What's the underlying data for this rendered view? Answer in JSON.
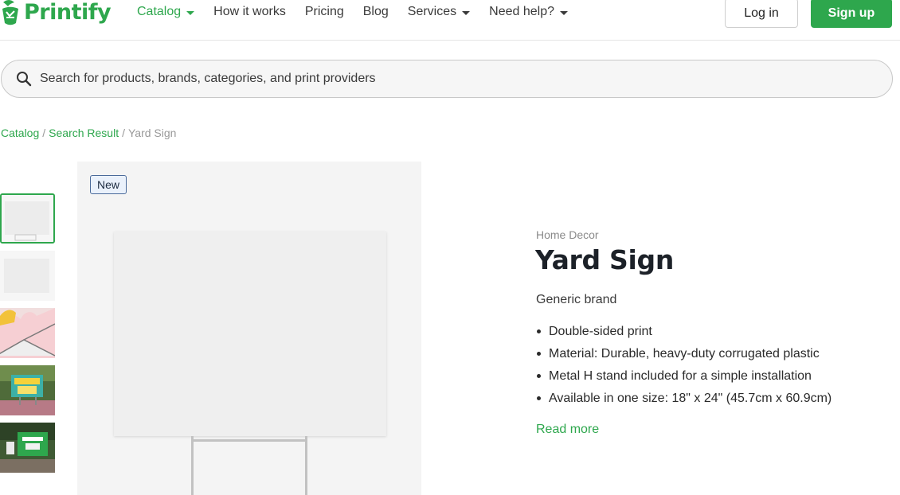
{
  "header": {
    "logo_text": "Printify",
    "nav": [
      {
        "label": "Catalog",
        "dropdown": true,
        "active": true
      },
      {
        "label": "How it works",
        "dropdown": false,
        "active": false
      },
      {
        "label": "Pricing",
        "dropdown": false,
        "active": false
      },
      {
        "label": "Blog",
        "dropdown": false,
        "active": false
      },
      {
        "label": "Services",
        "dropdown": true,
        "active": false
      },
      {
        "label": "Need help?",
        "dropdown": true,
        "active": false
      }
    ],
    "login_label": "Log in",
    "signup_label": "Sign up"
  },
  "search": {
    "placeholder": "Search for products, brands, categories, and print providers"
  },
  "breadcrumb": [
    {
      "label": "Catalog",
      "link": true
    },
    {
      "label": "Search Result",
      "link": true
    },
    {
      "label": "Yard Sign",
      "link": false
    }
  ],
  "gallery": {
    "badge": "New",
    "thumbnails": [
      "blank-sign-with-stand",
      "blank-sign",
      "illustrated-sign",
      "park-sign-photo",
      "yard-sign-photo"
    ],
    "selected_index": 0
  },
  "product": {
    "category": "Home Decor",
    "title": "Yard Sign",
    "brand": "Generic brand",
    "features": [
      "Double-sided print",
      "Material: Durable, heavy-duty corrugated plastic",
      "Metal H stand included for a simple installation",
      "Available in one size: 18\" x 24\" (45.7cm x 60.9cm)"
    ],
    "read_more": "Read more"
  },
  "colors": {
    "brand_green": "#2ea74d",
    "text_dark": "#1c2128",
    "badge_border": "#4a6a9a"
  }
}
